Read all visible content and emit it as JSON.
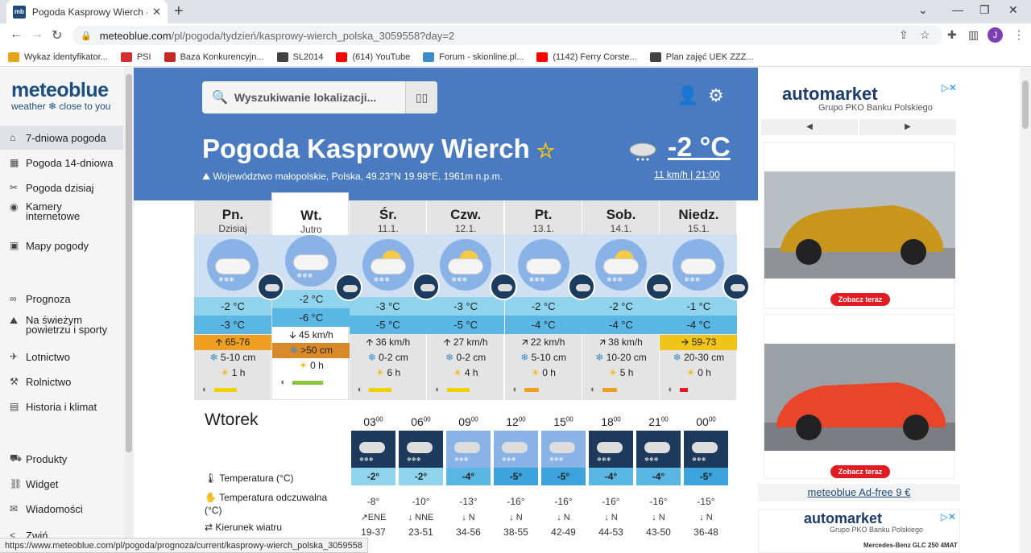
{
  "browser": {
    "tab_title": "Pogoda Kasprowy Wierch - mete",
    "url_host": "meteoblue.com",
    "url_path": "/pl/pogoda/tydzień/kasprowy-wierch_polska_3059558?day=2",
    "bookmarks": [
      {
        "label": "Wykaz identyfikator...",
        "color": "#e8a317"
      },
      {
        "label": "PSI",
        "color": "#d32f2f"
      },
      {
        "label": "Baza Konkurencyjn...",
        "color": "#c62828"
      },
      {
        "label": "SL2014",
        "color": "#424242"
      },
      {
        "label": "(614) YouTube",
        "color": "#ff0000"
      },
      {
        "label": "Forum - skionline.pl...",
        "color": "#3c8cc9"
      },
      {
        "label": "(1142) Ferry Corste...",
        "color": "#ff0000"
      },
      {
        "label": "Plan zajęć UEK ZZZ...",
        "color": "#424242"
      }
    ],
    "status_url": "https://www.meteoblue.com/pl/pogoda/prognoza/current/kasprowy-wierch_polska_3059558"
  },
  "sidebar": {
    "logo_main": "meteoblue",
    "logo_sub": "weather ❄ close to you",
    "items": [
      {
        "label": "7-dniowa pogoda",
        "icon": "⌂"
      },
      {
        "label": "Pogoda 14-dniowa",
        "icon": "▦"
      },
      {
        "label": "Pogoda dzisiaj",
        "icon": "✂"
      },
      {
        "label": "Kamery internetowe",
        "icon": "◉"
      },
      {
        "label": "Mapy pogody",
        "icon": "▣"
      },
      {
        "label": "Prognoza",
        "icon": "∞"
      },
      {
        "label": "Na świeżym powietrzu i sporty",
        "icon": "⛰"
      },
      {
        "label": "Lotnictwo",
        "icon": "✈"
      },
      {
        "label": "Rolnictwo",
        "icon": "⚒"
      },
      {
        "label": "Historia i klimat",
        "icon": "▤"
      },
      {
        "label": "Produkty",
        "icon": "⛟"
      },
      {
        "label": "Widget",
        "icon": "⛓"
      },
      {
        "label": "Wiadomości",
        "icon": "✉"
      },
      {
        "label": "Zwiń",
        "icon": "<"
      }
    ]
  },
  "header": {
    "search_placeholder": "Wyszukiwanie lokalizacji...",
    "city": "Pogoda Kasprowy Wierch",
    "location": "Województwo małopolskie, Polska, 49.23°N 19.98°E, 1961m n.p.m.",
    "current_temp": "-2 °C",
    "current_wind": "11 km/h",
    "current_time": "21:00"
  },
  "days": [
    {
      "name": "Pn.",
      "date": "Dzisiaj",
      "tmax": "-2 °C",
      "tmin": "-3 °C",
      "wind": "65-76",
      "wind_arrow": "🡩",
      "snow": "5-10 cm",
      "sun": "1 h",
      "pred_color": "#f0d000",
      "wind_hl": "#f0a020",
      "snow_hl": ""
    },
    {
      "name": "Wt.",
      "date": "Jutro",
      "tmax": "-2 °C",
      "tmin": "-6 °C",
      "wind": "45 km/h",
      "wind_arrow": "🡫",
      "snow": ">50 cm",
      "sun": "0 h",
      "pred_color": "#8cc63f",
      "wind_hl": "",
      "snow_hl": "#d88a2a"
    },
    {
      "name": "Śr.",
      "date": "11.1.",
      "tmax": "-3 °C",
      "tmin": "-5 °C",
      "wind": "36 km/h",
      "wind_arrow": "🡩",
      "snow": "0-2 cm",
      "sun": "6 h",
      "pred_color": "#f0d000",
      "wind_hl": "",
      "snow_hl": ""
    },
    {
      "name": "Czw.",
      "date": "12.1.",
      "tmax": "-3 °C",
      "tmin": "-5 °C",
      "wind": "27 km/h",
      "wind_arrow": "🡩",
      "snow": "0-2 cm",
      "sun": "4 h",
      "pred_color": "#f0d000",
      "wind_hl": "",
      "snow_hl": ""
    },
    {
      "name": "Pt.",
      "date": "13.1.",
      "tmax": "-2 °C",
      "tmin": "-4 °C",
      "wind": "22 km/h",
      "wind_arrow": "🡭",
      "snow": "5-10 cm",
      "sun": "0 h",
      "pred_color": "#f0a020",
      "wind_hl": "",
      "snow_hl": ""
    },
    {
      "name": "Sob.",
      "date": "14.1.",
      "tmax": "-2 °C",
      "tmin": "-4 °C",
      "wind": "38 km/h",
      "wind_arrow": "🡭",
      "snow": "10-20 cm",
      "sun": "5 h",
      "pred_color": "#f0a020",
      "wind_hl": "",
      "snow_hl": ""
    },
    {
      "name": "Niedz.",
      "date": "15.1.",
      "tmax": "-1 °C",
      "tmin": "-4 °C",
      "wind": "59-73",
      "wind_arrow": "🡪",
      "snow": "20-30 cm",
      "sun": "0 h",
      "pred_color": "#e31b23",
      "wind_hl": "#f0c419",
      "snow_hl": ""
    }
  ],
  "hourly": {
    "title": "Wtorek",
    "labels": {
      "temp": "Temperatura (°C)",
      "feel": "Temperatura odczuwalna (°C)",
      "dir": "Kierunek wiatru"
    },
    "hours": [
      {
        "h": "03",
        "temp": "-2°",
        "feel": "-8°",
        "dir": "↗ENE",
        "ws": "19-37",
        "bg": "#1d3a5c",
        "tbg": "#8fd3ec"
      },
      {
        "h": "06",
        "temp": "-2°",
        "feel": "-10°",
        "dir": "↓ NNE",
        "ws": "23-51",
        "bg": "#1d3a5c",
        "tbg": "#8fd3ec"
      },
      {
        "h": "09",
        "temp": "-4°",
        "feel": "-13°",
        "dir": "↓ N",
        "ws": "34-56",
        "bg": "#89b3e6",
        "tbg": "#5ab6e3"
      },
      {
        "h": "12",
        "temp": "-5°",
        "feel": "-16°",
        "dir": "↓ N",
        "ws": "38-55",
        "bg": "#89b3e6",
        "tbg": "#3da3dc"
      },
      {
        "h": "15",
        "temp": "-5°",
        "feel": "-16°",
        "dir": "↓ N",
        "ws": "42-49",
        "bg": "#89b3e6",
        "tbg": "#3da3dc"
      },
      {
        "h": "18",
        "temp": "-4°",
        "feel": "-16°",
        "dir": "↓ N",
        "ws": "44-53",
        "bg": "#1d3a5c",
        "tbg": "#5ab6e3"
      },
      {
        "h": "21",
        "temp": "-4°",
        "feel": "-16°",
        "dir": "↓ N",
        "ws": "43-50",
        "bg": "#1d3a5c",
        "tbg": "#5ab6e3"
      },
      {
        "h": "00",
        "temp": "-5°",
        "feel": "-15°",
        "dir": "↓ N",
        "ws": "36-48",
        "bg": "#1d3a5c",
        "tbg": "#3da3dc"
      }
    ]
  },
  "ads": {
    "brand": "automarket",
    "brand_sub": "Grupo PKO Banku Polskiego",
    "cta": "Zobacz teraz",
    "adfree": "meteoblue Ad-free 9 €",
    "ad2_line": "Mercedes-Benz GLC 250 4MAT"
  }
}
